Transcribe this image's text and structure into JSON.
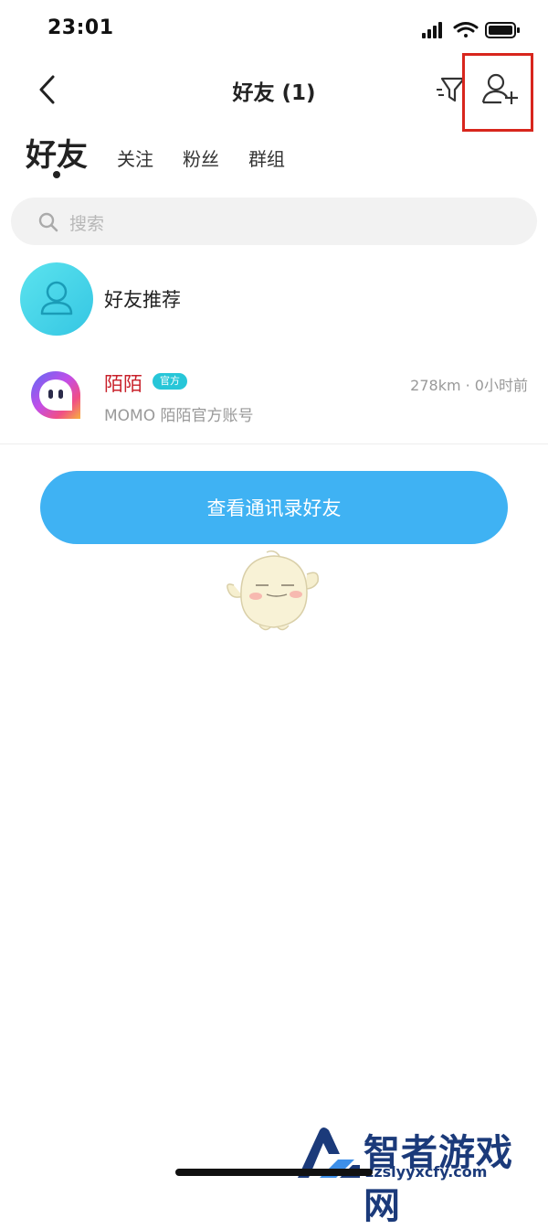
{
  "status_bar": {
    "time": "23:01"
  },
  "nav": {
    "title": "好友 (1)"
  },
  "tabs": [
    "好友",
    "关注",
    "粉丝",
    "群组"
  ],
  "search": {
    "placeholder": "搜索"
  },
  "recommend": {
    "label": "好友推荐"
  },
  "friends": [
    {
      "name": "陌陌",
      "badge": "官方",
      "meta": "278km · 0小时前",
      "desc": "MOMO 陌陌官方账号"
    }
  ],
  "contacts_button": {
    "label": "查看通讯录好友"
  },
  "watermark": {
    "text": "智者游戏网",
    "url": "zzslyyxcfy.com"
  },
  "colors": {
    "accent": "#3fb2f3",
    "name_red": "#c8202a",
    "badge": "#27c6d8",
    "highlight": "#d8261d"
  },
  "icons": [
    "back-icon",
    "filter-icon",
    "add-friend-icon",
    "search-icon",
    "user-icon",
    "momo-logo"
  ]
}
